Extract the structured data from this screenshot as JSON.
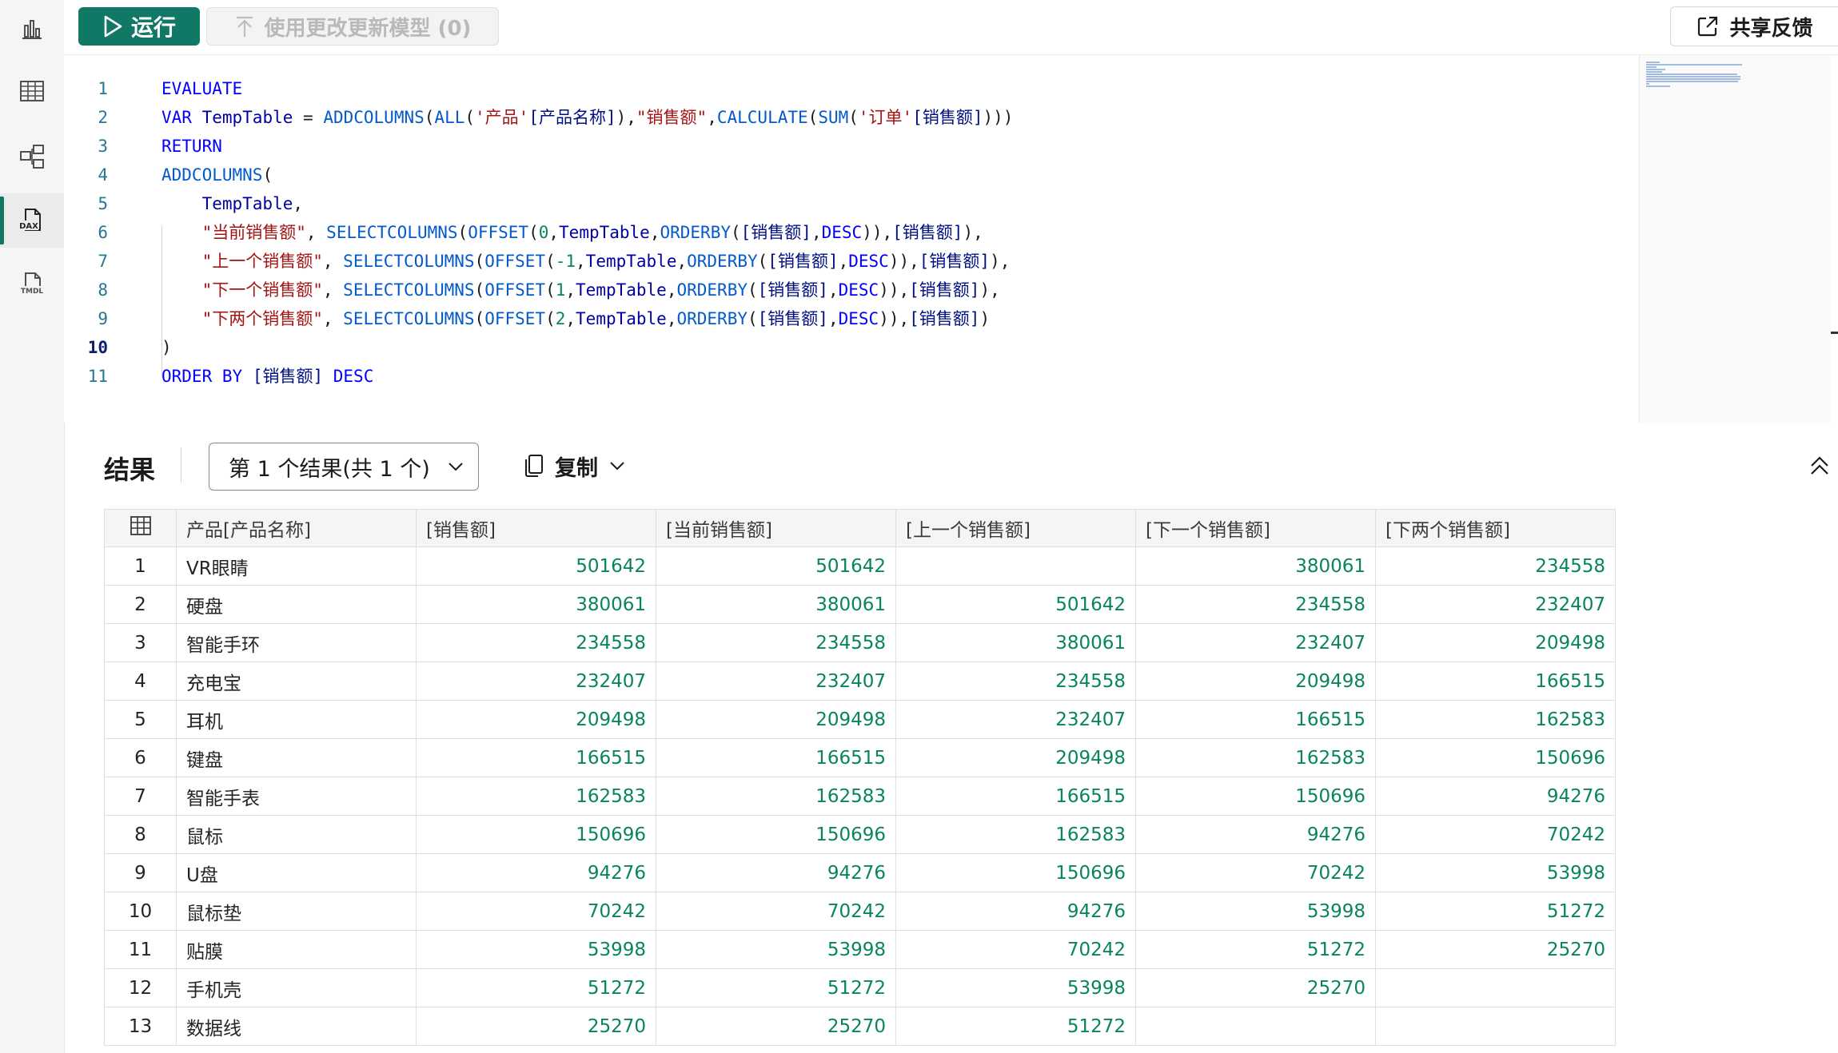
{
  "toolbar": {
    "run_label": "运行",
    "update_label": "使用更改更新模型 (0)",
    "feedback_label": "共享反馈"
  },
  "rail": {
    "items": [
      {
        "icon": "report-icon"
      },
      {
        "icon": "table-view-icon"
      },
      {
        "icon": "model-view-icon"
      },
      {
        "icon": "dax-query-icon",
        "label": "DAX",
        "active": true
      },
      {
        "icon": "tmdl-icon",
        "label": "TMDL"
      }
    ]
  },
  "editor": {
    "current_line": 10,
    "lines": [
      {
        "n": "1",
        "tokens": [
          [
            "kw",
            "EVALUATE"
          ]
        ]
      },
      {
        "n": "2",
        "tokens": [
          [
            "kw",
            "VAR"
          ],
          [
            "pl",
            " "
          ],
          [
            "tb",
            "TempTable"
          ],
          [
            "pl",
            " = "
          ],
          [
            "fn",
            "ADDCOLUMNS"
          ],
          [
            "pl",
            "("
          ],
          [
            "fn",
            "ALL"
          ],
          [
            "pl",
            "("
          ],
          [
            "str",
            "'产品'"
          ],
          [
            "col",
            "[产品名称]"
          ],
          [
            "pl",
            "),"
          ],
          [
            "str",
            "\"销售额\""
          ],
          [
            "pl",
            ","
          ],
          [
            "fn",
            "CALCULATE"
          ],
          [
            "pl",
            "("
          ],
          [
            "fn",
            "SUM"
          ],
          [
            "pl",
            "("
          ],
          [
            "str",
            "'订单'"
          ],
          [
            "col",
            "[销售额]"
          ],
          [
            "pl",
            ")))"
          ]
        ]
      },
      {
        "n": "3",
        "tokens": [
          [
            "kw",
            "RETURN"
          ]
        ]
      },
      {
        "n": "4",
        "tokens": [
          [
            "fn",
            "ADDCOLUMNS"
          ],
          [
            "pl",
            "("
          ]
        ]
      },
      {
        "n": "5",
        "tokens": [
          [
            "pl",
            "    "
          ],
          [
            "tb",
            "TempTable"
          ],
          [
            "pl",
            ","
          ]
        ]
      },
      {
        "n": "6",
        "tokens": [
          [
            "pl",
            "    "
          ],
          [
            "str",
            "\"当前销售额\""
          ],
          [
            "pl",
            ", "
          ],
          [
            "fn",
            "SELECTCOLUMNS"
          ],
          [
            "pl",
            "("
          ],
          [
            "fn",
            "OFFSET"
          ],
          [
            "pl",
            "("
          ],
          [
            "num",
            "0"
          ],
          [
            "pl",
            ","
          ],
          [
            "tb",
            "TempTable"
          ],
          [
            "pl",
            ","
          ],
          [
            "fn",
            "ORDERBY"
          ],
          [
            "pl",
            "("
          ],
          [
            "col",
            "[销售额]"
          ],
          [
            "pl",
            ","
          ],
          [
            "kw",
            "DESC"
          ],
          [
            "pl",
            "))"
          ],
          [
            "pl",
            ","
          ],
          [
            "col",
            "[销售额]"
          ],
          [
            "pl",
            "),"
          ]
        ]
      },
      {
        "n": "7",
        "tokens": [
          [
            "pl",
            "    "
          ],
          [
            "str",
            "\"上一个销售额\""
          ],
          [
            "pl",
            ", "
          ],
          [
            "fn",
            "SELECTCOLUMNS"
          ],
          [
            "pl",
            "("
          ],
          [
            "fn",
            "OFFSET"
          ],
          [
            "pl",
            "("
          ],
          [
            "num",
            "-1"
          ],
          [
            "pl",
            ","
          ],
          [
            "tb",
            "TempTable"
          ],
          [
            "pl",
            ","
          ],
          [
            "fn",
            "ORDERBY"
          ],
          [
            "pl",
            "("
          ],
          [
            "col",
            "[销售额]"
          ],
          [
            "pl",
            ","
          ],
          [
            "kw",
            "DESC"
          ],
          [
            "pl",
            "))"
          ],
          [
            "pl",
            ","
          ],
          [
            "col",
            "[销售额]"
          ],
          [
            "pl",
            "),"
          ]
        ]
      },
      {
        "n": "8",
        "tokens": [
          [
            "pl",
            "    "
          ],
          [
            "str",
            "\"下一个销售额\""
          ],
          [
            "pl",
            ", "
          ],
          [
            "fn",
            "SELECTCOLUMNS"
          ],
          [
            "pl",
            "("
          ],
          [
            "fn",
            "OFFSET"
          ],
          [
            "pl",
            "("
          ],
          [
            "num",
            "1"
          ],
          [
            "pl",
            ","
          ],
          [
            "tb",
            "TempTable"
          ],
          [
            "pl",
            ","
          ],
          [
            "fn",
            "ORDERBY"
          ],
          [
            "pl",
            "("
          ],
          [
            "col",
            "[销售额]"
          ],
          [
            "pl",
            ","
          ],
          [
            "kw",
            "DESC"
          ],
          [
            "pl",
            "))"
          ],
          [
            "pl",
            ","
          ],
          [
            "col",
            "[销售额]"
          ],
          [
            "pl",
            "),"
          ]
        ]
      },
      {
        "n": "9",
        "tokens": [
          [
            "pl",
            "    "
          ],
          [
            "str",
            "\"下两个销售额\""
          ],
          [
            "pl",
            ", "
          ],
          [
            "fn",
            "SELECTCOLUMNS"
          ],
          [
            "pl",
            "("
          ],
          [
            "fn",
            "OFFSET"
          ],
          [
            "pl",
            "("
          ],
          [
            "num",
            "2"
          ],
          [
            "pl",
            ","
          ],
          [
            "tb",
            "TempTable"
          ],
          [
            "pl",
            ","
          ],
          [
            "fn",
            "ORDERBY"
          ],
          [
            "pl",
            "("
          ],
          [
            "col",
            "[销售额]"
          ],
          [
            "pl",
            ","
          ],
          [
            "kw",
            "DESC"
          ],
          [
            "pl",
            "))"
          ],
          [
            "pl",
            ","
          ],
          [
            "col",
            "[销售额]"
          ],
          [
            "pl",
            ")"
          ]
        ]
      },
      {
        "n": "10",
        "tokens": [
          [
            "pl",
            ")"
          ]
        ]
      },
      {
        "n": "11",
        "tokens": [
          [
            "kw",
            "ORDER BY"
          ],
          [
            "pl",
            " "
          ],
          [
            "col",
            "[销售额]"
          ],
          [
            "pl",
            " "
          ],
          [
            "kw",
            "DESC"
          ]
        ]
      }
    ]
  },
  "results": {
    "title": "结果",
    "selector_label": "第 1 个结果(共 1 个)",
    "copy_label": "复制",
    "columns": [
      "产品[产品名称]",
      "[销售额]",
      "[当前销售额]",
      "[上一个销售额]",
      "[下一个销售额]",
      "[下两个销售额]"
    ],
    "rows": [
      [
        "1",
        "VR眼睛",
        "501642",
        "501642",
        "",
        "380061",
        "234558"
      ],
      [
        "2",
        "硬盘",
        "380061",
        "380061",
        "501642",
        "234558",
        "232407"
      ],
      [
        "3",
        "智能手环",
        "234558",
        "234558",
        "380061",
        "232407",
        "209498"
      ],
      [
        "4",
        "充电宝",
        "232407",
        "232407",
        "234558",
        "209498",
        "166515"
      ],
      [
        "5",
        "耳机",
        "209498",
        "209498",
        "232407",
        "166515",
        "162583"
      ],
      [
        "6",
        "键盘",
        "166515",
        "166515",
        "209498",
        "162583",
        "150696"
      ],
      [
        "7",
        "智能手表",
        "162583",
        "162583",
        "166515",
        "150696",
        "94276"
      ],
      [
        "8",
        "鼠标",
        "150696",
        "150696",
        "162583",
        "94276",
        "70242"
      ],
      [
        "9",
        "U盘",
        "94276",
        "94276",
        "150696",
        "70242",
        "53998"
      ],
      [
        "10",
        "鼠标垫",
        "70242",
        "70242",
        "94276",
        "53998",
        "51272"
      ],
      [
        "11",
        "贴膜",
        "53998",
        "53998",
        "70242",
        "51272",
        "25270"
      ],
      [
        "12",
        "手机壳",
        "51272",
        "51272",
        "53998",
        "25270",
        ""
      ],
      [
        "13",
        "数据线",
        "25270",
        "25270",
        "51272",
        "",
        ""
      ]
    ]
  },
  "colors": {
    "accent": "#117865",
    "keyword": "#0000ff",
    "function": "#035aca",
    "string": "#a31515",
    "column_ref": "#001080",
    "line_number": "#237893"
  }
}
